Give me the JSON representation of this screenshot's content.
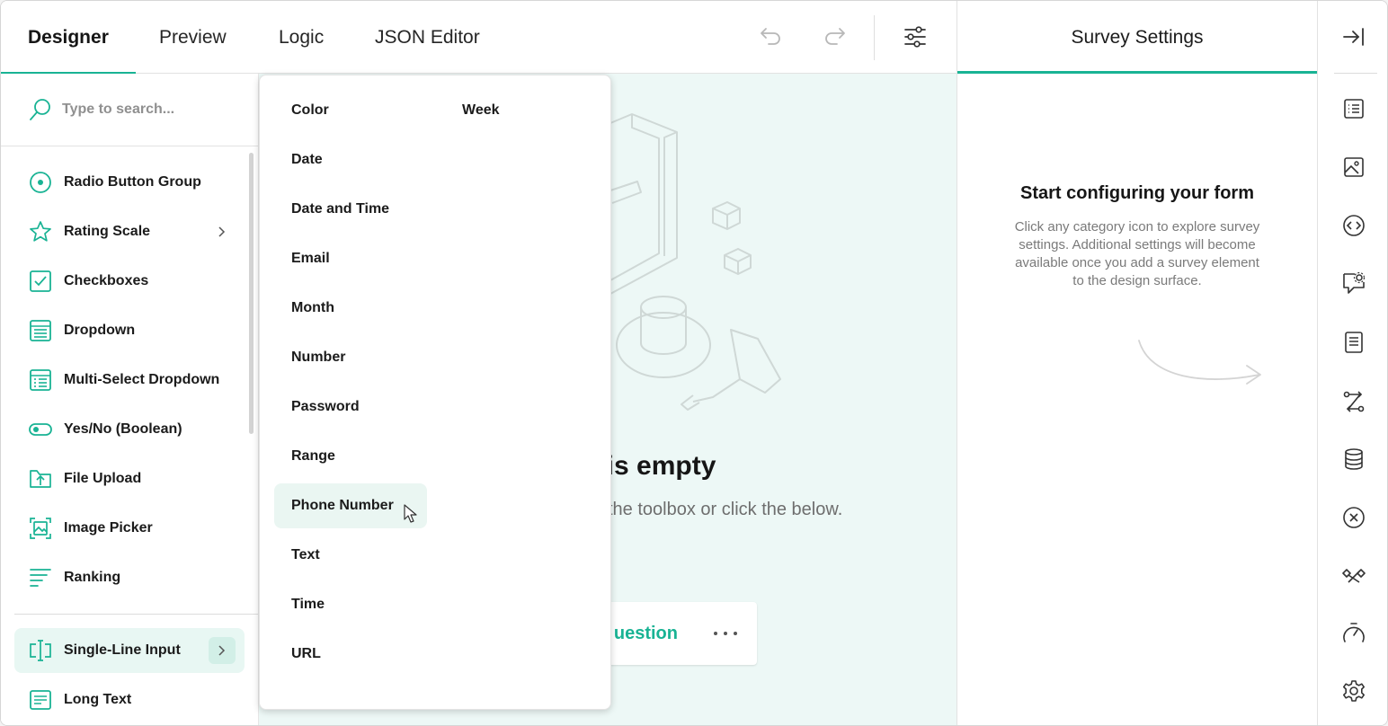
{
  "colors": {
    "accent": "#19b394",
    "accent_light": "#e8f7f3",
    "canvas_bg": "#edf8f6",
    "text": "#161616",
    "muted": "#7a7a7a"
  },
  "header": {
    "tabs": [
      {
        "label": "Designer",
        "active": true
      },
      {
        "label": "Preview"
      },
      {
        "label": "Logic"
      },
      {
        "label": "JSON Editor"
      }
    ],
    "icons": [
      "undo-icon",
      "redo-icon",
      "settings-sliders-icon"
    ]
  },
  "toolbox": {
    "search_placeholder": "Type to search...",
    "items": [
      {
        "label": "Radio Button Group",
        "icon": "radio-icon"
      },
      {
        "label": "Rating Scale",
        "icon": "star-icon",
        "has_submenu": true
      },
      {
        "label": "Checkboxes",
        "icon": "checkbox-icon"
      },
      {
        "label": "Dropdown",
        "icon": "dropdown-icon"
      },
      {
        "label": "Multi-Select Dropdown",
        "icon": "multi-dropdown-icon"
      },
      {
        "label": "Yes/No (Boolean)",
        "icon": "toggle-icon"
      },
      {
        "label": "File Upload",
        "icon": "file-upload-icon"
      },
      {
        "label": "Image Picker",
        "icon": "image-picker-icon"
      },
      {
        "label": "Ranking",
        "icon": "ranking-icon"
      },
      {
        "label": "Single-Line Input",
        "icon": "text-cursor-icon",
        "has_submenu": true,
        "active": true
      },
      {
        "label": "Long Text",
        "icon": "long-text-icon"
      }
    ]
  },
  "submenu": {
    "items": [
      "Color",
      "Week",
      "Date",
      "Date and Time",
      "Email",
      "Month",
      "Number",
      "Password",
      "Range",
      "Phone Number",
      "Text",
      "Time",
      "URL"
    ],
    "hovered": "Phone Number"
  },
  "canvas": {
    "empty_title": "n is empty",
    "empty_subtitle": "the toolbox or click the below.",
    "add_button_label": "uestion"
  },
  "settings_panel": {
    "title": "Survey Settings",
    "heading": "Start configuring your form",
    "description": "Click any category icon to explore survey settings. Additional settings will become available once you add a survey element to the design surface."
  },
  "rail": {
    "icons": [
      "collapse-panel-icon",
      "general-list-icon",
      "logo-image-icon",
      "navigation-icon",
      "question-settings-icon",
      "pages-icon",
      "logic-icon",
      "data-icon",
      "validation-icon",
      "conditions-icon",
      "timer-icon",
      "gear-icon"
    ]
  }
}
